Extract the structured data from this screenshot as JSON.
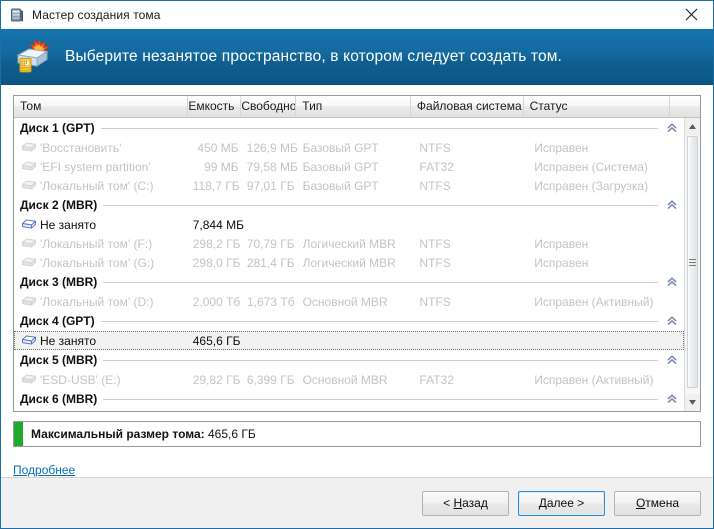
{
  "window": {
    "title": "Мастер создания тома",
    "title_icon": "disk-drive-icon",
    "close_label": "Закрыть"
  },
  "banner": {
    "icon": "new-volume-disk-icon",
    "title": "Выберите незанятое пространство, в котором следует создать том."
  },
  "grid": {
    "columns": [
      {
        "key": "volume",
        "label": "Том"
      },
      {
        "key": "capacity",
        "label": "Емкость"
      },
      {
        "key": "free",
        "label": "Свободно"
      },
      {
        "key": "type",
        "label": "Тип"
      },
      {
        "key": "fs",
        "label": "Файловая система"
      },
      {
        "key": "status",
        "label": "Статус"
      }
    ],
    "groups": [
      {
        "label": "Диск 1 (GPT)",
        "collapse_icon": "double-chevron-up-icon",
        "rows": [
          {
            "icon": "volume-disk-icon",
            "volume": "'Восстановить'",
            "capacity": "450 МБ",
            "free": "126,9 МБ",
            "type": "Базовый GPT",
            "fs": "NTFS",
            "status": "Исправен",
            "enabled": false,
            "selected": false
          },
          {
            "icon": "volume-disk-icon",
            "volume": "'EFI system partition'",
            "capacity": "99 МБ",
            "free": "79,58 МБ",
            "type": "Базовый GPT",
            "fs": "FAT32",
            "status": "Исправен (Система)",
            "enabled": false,
            "selected": false
          },
          {
            "icon": "volume-disk-icon",
            "volume": "'Локальный том' (C:)",
            "capacity": "118,7 ГБ",
            "free": "97,01 ГБ",
            "type": "Базовый GPT",
            "fs": "NTFS",
            "status": "Исправен (Загрузка)",
            "enabled": false,
            "selected": false
          }
        ]
      },
      {
        "label": "Диск 2 (MBR)",
        "collapse_icon": "double-chevron-up-icon",
        "rows": [
          {
            "icon": "unallocated-disk-icon",
            "volume": "Не занято",
            "capacity": "7,844 МБ",
            "free": "",
            "type": "",
            "fs": "",
            "status": "",
            "enabled": true,
            "selected": false
          },
          {
            "icon": "volume-disk-icon",
            "volume": "'Локальный том' (F:)",
            "capacity": "298,2 ГБ",
            "free": "70,79 ГБ",
            "type": "Логический MBR",
            "fs": "NTFS",
            "status": "Исправен",
            "enabled": false,
            "selected": false
          },
          {
            "icon": "volume-disk-icon",
            "volume": "'Локальный том' (G:)",
            "capacity": "298,0 ГБ",
            "free": "281,4 ГБ",
            "type": "Логический MBR",
            "fs": "NTFS",
            "status": "Исправен",
            "enabled": false,
            "selected": false
          }
        ]
      },
      {
        "label": "Диск 3 (MBR)",
        "collapse_icon": "double-chevron-up-icon",
        "rows": [
          {
            "icon": "removable-disk-icon",
            "volume": "'Локальный том' (D:)",
            "capacity": "2,000 Тб",
            "free": "1,673 Тб",
            "type": "Основной MBR",
            "fs": "NTFS",
            "status": "Исправен (Активный)",
            "enabled": false,
            "selected": false
          }
        ]
      },
      {
        "label": "Диск 4 (GPT)",
        "collapse_icon": "double-chevron-up-icon",
        "rows": [
          {
            "icon": "unallocated-disk-icon",
            "volume": "Не занято",
            "capacity": "465,6 ГБ",
            "free": "",
            "type": "",
            "fs": "",
            "status": "",
            "enabled": true,
            "selected": true
          }
        ]
      },
      {
        "label": "Диск 5 (MBR)",
        "collapse_icon": "double-chevron-up-icon",
        "rows": [
          {
            "icon": "removable-disk-icon",
            "volume": "'ESD-USB' (E:)",
            "capacity": "29,82 ГБ",
            "free": "6,399 ГБ",
            "type": "Основной MBR",
            "fs": "FAT32",
            "status": "Исправен (Активный)",
            "enabled": false,
            "selected": false
          }
        ]
      },
      {
        "label": "Диск 6 (MBR)",
        "collapse_icon": "double-chevron-up-icon",
        "rows": []
      }
    ],
    "scrollbar": {
      "up_icon": "scroll-up-arrow-icon",
      "down_icon": "scroll-down-arrow-icon",
      "thumb_icon": "scroll-thumb-grip-icon"
    }
  },
  "max_size": {
    "swatch_color": "#1faa2e",
    "label": "Максимальный размер тома:",
    "value": "465,6 ГБ"
  },
  "more_link": {
    "label": "Подробнее"
  },
  "footer": {
    "back_prefix": "< ",
    "back_underlined": "Н",
    "back_rest": "азад",
    "next_prefix": "",
    "next_underlined": "Д",
    "next_rest": "алее >",
    "cancel_underlined": "О",
    "cancel_rest": "тмена"
  },
  "colors": {
    "banner_top": "#1574ad",
    "banner_bottom": "#0d5685",
    "accent_link": "#0a6ebd",
    "default_button_border": "#2a8dd4",
    "green": "#1faa2e"
  }
}
